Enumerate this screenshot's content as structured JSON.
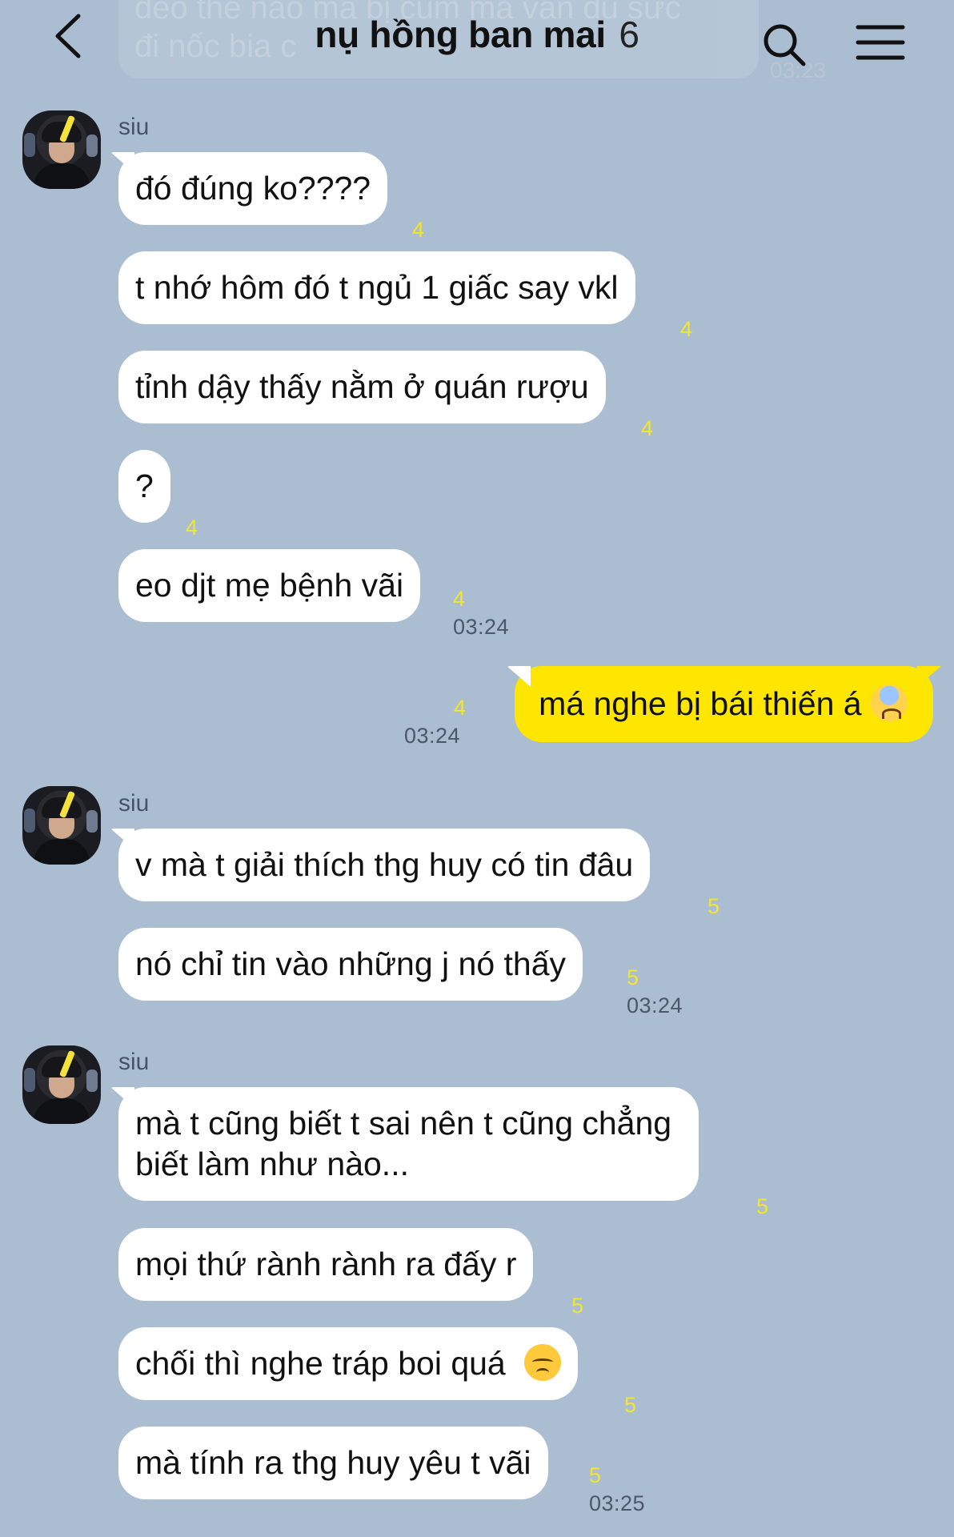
{
  "header": {
    "title": "nụ hồng ban mai",
    "member_count": "6",
    "ghost_text": "đéo thế nào mà bị cùm mà vẫn đủ sức\nđi nốc bia c",
    "ghost_time": "03:23"
  },
  "groups": [
    {
      "sender": "siu",
      "messages": [
        {
          "text": "đó đúng ko????",
          "unread": "4"
        },
        {
          "text": "t nhớ hôm đó t ngủ 1 giấc say vkl",
          "unread": "4"
        },
        {
          "text": "tỉnh dậy thấy nằm ở quán rượu",
          "unread": "4"
        },
        {
          "text": "?",
          "unread": "4"
        },
        {
          "text": "eo djt mẹ bệnh vãi",
          "unread": "4",
          "time": "03:24"
        }
      ]
    },
    {
      "self": true,
      "messages": [
        {
          "text": "má nghe bị bái thiến á",
          "emoji": "anxious-face-with-sweat-icon",
          "unread": "4",
          "time": "03:24"
        }
      ]
    },
    {
      "sender": "siu",
      "messages": [
        {
          "text": "v mà t giải thích thg huy có tin đâu",
          "unread": "5"
        },
        {
          "text": "nó chỉ tin vào những j nó thấy",
          "unread": "5",
          "time": "03:24"
        }
      ]
    },
    {
      "sender": "siu",
      "messages": [
        {
          "text_line1": "mà t cũng biết t sai nên t cũng chẳng",
          "text_line2": "biết làm như nào...",
          "unread": "5"
        },
        {
          "text": "mọi thứ rành rành ra đấy r",
          "unread": "5"
        },
        {
          "text": "chối thì nghe tráp boi quá",
          "emoji": "disappointed-face-icon",
          "unread": "5"
        },
        {
          "text": "mà tính ra thg huy yêu t vãi",
          "unread": "5",
          "time": "03:25"
        }
      ]
    }
  ],
  "colors": {
    "background": "#aabdd1",
    "incoming_bubble": "#ffffff",
    "outgoing_bubble": "#ffe600",
    "unread_count": "#f4e62c"
  }
}
